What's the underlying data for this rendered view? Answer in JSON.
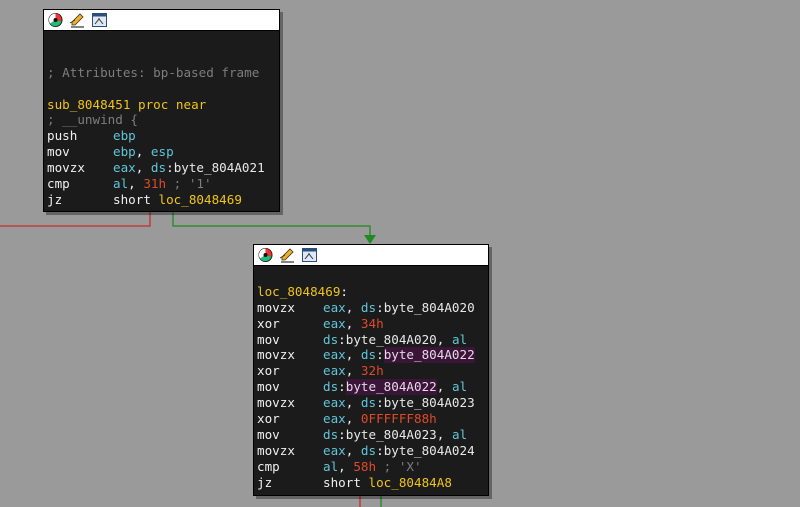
{
  "colors": {
    "background": "#9a9a9a",
    "node_bg": "#1b1b1b",
    "edge_false": "#cc2a2a",
    "edge_true": "#1f8a1f",
    "comment": "#7d7d7d",
    "name": "#f0c419",
    "register": "#61c5d8",
    "immediate": "#e04a2a",
    "highlight": "#3a1538"
  },
  "node1": {
    "toolbar": [
      "color-wheel-icon",
      "rename-pencil-icon",
      "graph-view-icon"
    ],
    "lines": [
      {
        "text": ""
      },
      {
        "text": ""
      },
      {
        "comment": "; Attributes: bp-based frame"
      },
      {
        "text": ""
      },
      {
        "name": "sub_8048451",
        "kw": "proc near"
      },
      {
        "comment": "; __unwind {"
      },
      {
        "mn": "push",
        "ops": [
          {
            "t": "ebp",
            "c": "reg"
          }
        ]
      },
      {
        "mn": "mov",
        "ops": [
          {
            "t": "ebp",
            "c": "reg"
          },
          {
            "t": ", ",
            "c": "punct"
          },
          {
            "t": "esp",
            "c": "reg"
          }
        ]
      },
      {
        "mn": "movzx",
        "ops": [
          {
            "t": "eax",
            "c": "reg"
          },
          {
            "t": ", ",
            "c": "punct"
          },
          {
            "t": "ds",
            "c": "seg"
          },
          {
            "t": ":",
            "c": "punct"
          },
          {
            "t": "byte_804A021",
            "c": "var"
          }
        ]
      },
      {
        "mn": "cmp",
        "ops": [
          {
            "t": "al",
            "c": "reg"
          },
          {
            "t": ", ",
            "c": "punct"
          },
          {
            "t": "31h",
            "c": "hex"
          },
          {
            "t": " ; '1'",
            "c": "str"
          }
        ]
      },
      {
        "mn": "jz",
        "ops": [
          {
            "t": "short ",
            "c": "punct"
          },
          {
            "t": "loc_8048469",
            "c": "loc"
          }
        ]
      }
    ]
  },
  "node2": {
    "toolbar": [
      "color-wheel-icon",
      "rename-pencil-icon",
      "graph-view-icon"
    ],
    "lines": [
      {
        "text": ""
      },
      {
        "label": "loc_8048469",
        "colon": ":"
      },
      {
        "mn": "movzx",
        "ops": [
          {
            "t": "eax",
            "c": "reg"
          },
          {
            "t": ", ",
            "c": "punct"
          },
          {
            "t": "ds",
            "c": "seg"
          },
          {
            "t": ":",
            "c": "punct"
          },
          {
            "t": "byte_804A020",
            "c": "var"
          }
        ]
      },
      {
        "mn": "xor",
        "ops": [
          {
            "t": "eax",
            "c": "reg"
          },
          {
            "t": ", ",
            "c": "punct"
          },
          {
            "t": "34h",
            "c": "hex"
          }
        ]
      },
      {
        "mn": "mov",
        "ops": [
          {
            "t": "ds",
            "c": "seg"
          },
          {
            "t": ":",
            "c": "punct"
          },
          {
            "t": "byte_804A020",
            "c": "var"
          },
          {
            "t": ", ",
            "c": "punct"
          },
          {
            "t": "al",
            "c": "reg"
          }
        ]
      },
      {
        "mn": "movzx",
        "ops": [
          {
            "t": "eax",
            "c": "reg"
          },
          {
            "t": ", ",
            "c": "punct"
          },
          {
            "t": "ds",
            "c": "seg"
          },
          {
            "t": ":",
            "c": "punct"
          },
          {
            "t": "byte_804A022",
            "c": "hl"
          }
        ]
      },
      {
        "mn": "xor",
        "ops": [
          {
            "t": "eax",
            "c": "reg"
          },
          {
            "t": ", ",
            "c": "punct"
          },
          {
            "t": "32h",
            "c": "hex"
          }
        ]
      },
      {
        "mn": "mov",
        "ops": [
          {
            "t": "ds",
            "c": "seg"
          },
          {
            "t": ":",
            "c": "punct"
          },
          {
            "t": "byte_804A022",
            "c": "hl"
          },
          {
            "t": ", ",
            "c": "punct"
          },
          {
            "t": "al",
            "c": "reg"
          }
        ]
      },
      {
        "mn": "movzx",
        "ops": [
          {
            "t": "eax",
            "c": "reg"
          },
          {
            "t": ", ",
            "c": "punct"
          },
          {
            "t": "ds",
            "c": "seg"
          },
          {
            "t": ":",
            "c": "punct"
          },
          {
            "t": "byte_804A023",
            "c": "var"
          }
        ]
      },
      {
        "mn": "xor",
        "ops": [
          {
            "t": "eax",
            "c": "reg"
          },
          {
            "t": ", ",
            "c": "punct"
          },
          {
            "t": "0FFFFFF88h",
            "c": "hex"
          }
        ]
      },
      {
        "mn": "mov",
        "ops": [
          {
            "t": "ds",
            "c": "seg"
          },
          {
            "t": ":",
            "c": "punct"
          },
          {
            "t": "byte_804A023",
            "c": "var"
          },
          {
            "t": ", ",
            "c": "punct"
          },
          {
            "t": "al",
            "c": "reg"
          }
        ]
      },
      {
        "mn": "movzx",
        "ops": [
          {
            "t": "eax",
            "c": "reg"
          },
          {
            "t": ", ",
            "c": "punct"
          },
          {
            "t": "ds",
            "c": "seg"
          },
          {
            "t": ":",
            "c": "punct"
          },
          {
            "t": "byte_804A024",
            "c": "var"
          }
        ]
      },
      {
        "mn": "cmp",
        "ops": [
          {
            "t": "al",
            "c": "reg"
          },
          {
            "t": ", ",
            "c": "punct"
          },
          {
            "t": "58h",
            "c": "hex"
          },
          {
            "t": " ; 'X'",
            "c": "str"
          }
        ]
      },
      {
        "mn": "jz",
        "ops": [
          {
            "t": "short ",
            "c": "punct"
          },
          {
            "t": "loc_80484A8",
            "c": "loc"
          }
        ]
      }
    ]
  }
}
